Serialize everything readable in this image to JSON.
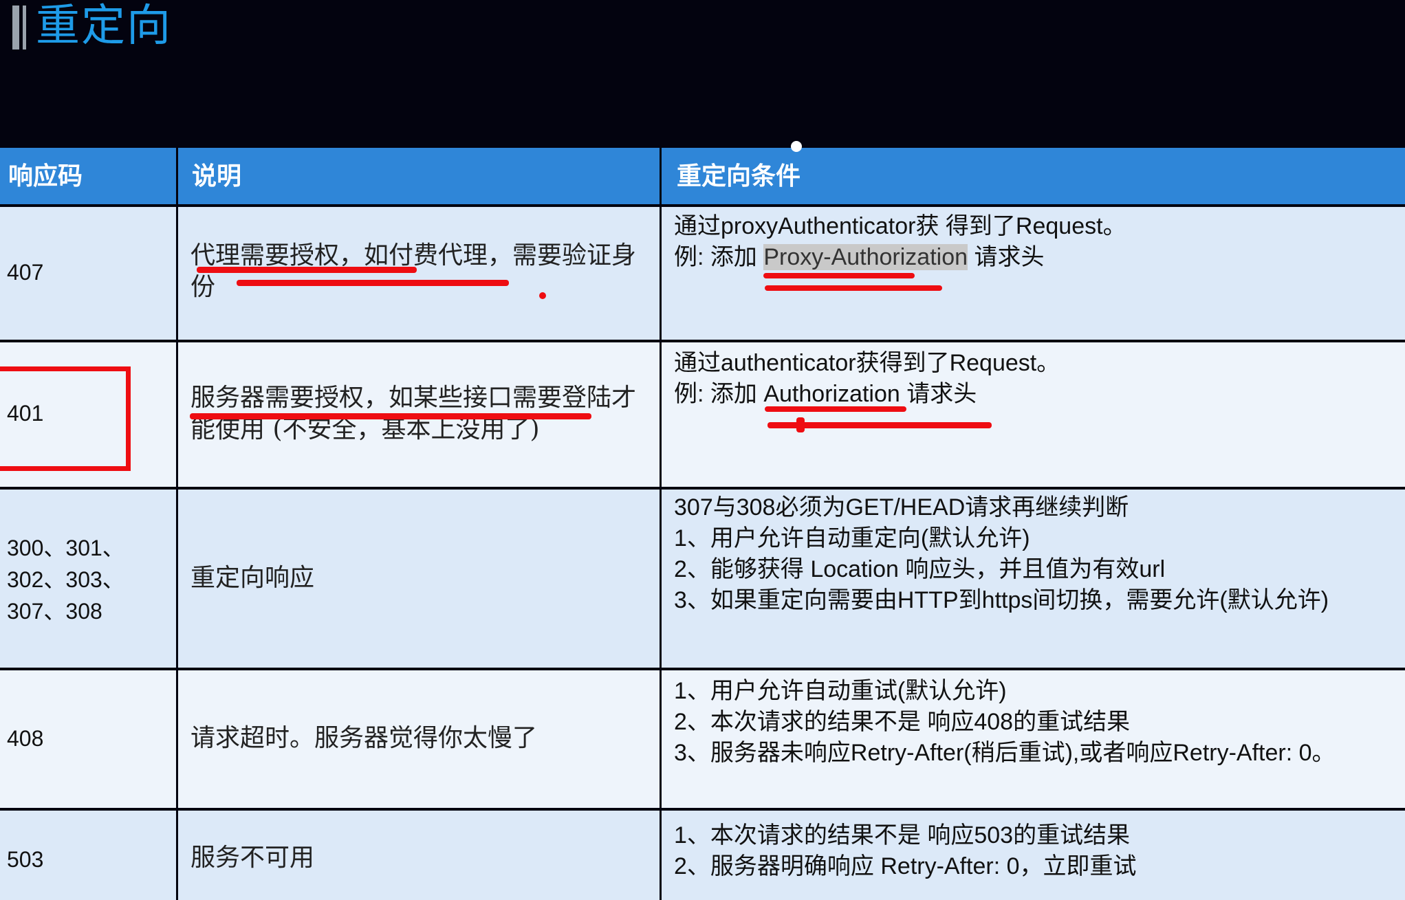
{
  "title": "重定向",
  "header": {
    "col1": "响应码",
    "col2": "说明",
    "col3": "重定向条件"
  },
  "rows": [
    {
      "code": "407",
      "desc": "代理需要授权，如付费代理，需要验证身份",
      "cond": {
        "line1": "通过proxyAuthenticator获 得到了Request。",
        "line2_prefix": "例: 添加 ",
        "line2_highlight": "Proxy-Authorization",
        "line2_suffix": " 请求头"
      }
    },
    {
      "code": "401",
      "desc": "服务器需要授权，如某些接口需要登陆才能使用 (不安全，基本上没用了)",
      "cond": {
        "line1": "通过authenticator获得到了Request。",
        "line2_prefix": "例: 添加 ",
        "line2_highlight": "Authorization",
        "line2_suffix": " 请求头"
      }
    },
    {
      "code_lines": [
        "300、301、",
        "302、303、",
        "307、308"
      ],
      "desc": "重定向响应",
      "cond_lines": [
        "307与308必须为GET/HEAD请求再继续判断",
        "1、用户允许自动重定向(默认允许)",
        "2、能够获得 Location 响应头，并且值为有效url",
        "3、如果重定向需要由HTTP到https间切换，需要允许(默认允许)"
      ]
    },
    {
      "code": "408",
      "desc": "请求超时。服务器觉得你太慢了",
      "cond_lines": [
        "1、用户允许自动重试(默认允许)",
        "2、本次请求的结果不是 响应408的重试结果",
        "3、服务器未响应Retry-After(稍后重试),或者响应Retry-After: 0。"
      ]
    },
    {
      "code": "503",
      "desc": "服务不可用",
      "cond_lines": [
        "1、本次请求的结果不是 响应503的重试结果",
        "2、服务器明确响应 Retry-After: 0，立即重试"
      ]
    }
  ],
  "colors": {
    "title": "#1e9be8",
    "header_bg": "#2f86d8",
    "row_odd": "#dce9f8",
    "row_even": "#eef4fb",
    "annotation": "#ee0d12"
  }
}
